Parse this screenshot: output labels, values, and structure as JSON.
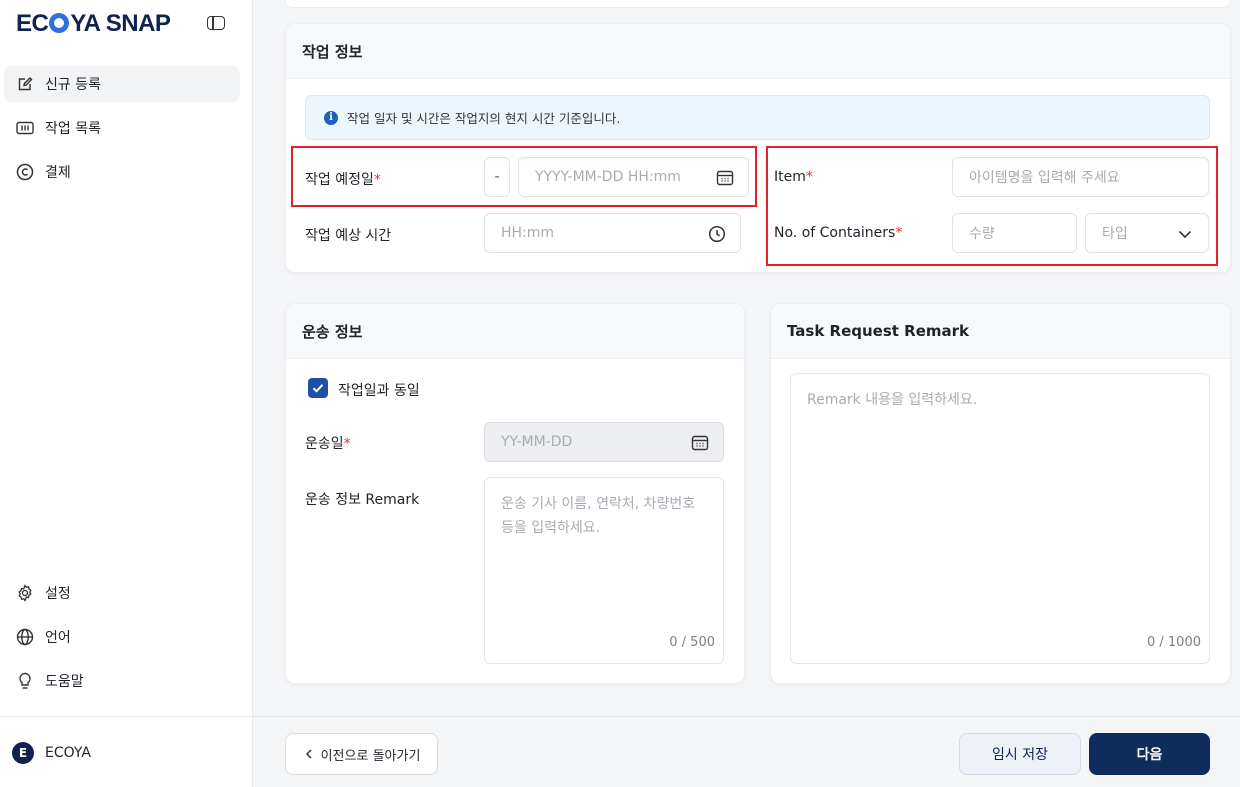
{
  "app": {
    "logo_text_pre": "EC",
    "logo_text_post": "YA SNAP"
  },
  "sidebar": {
    "items": [
      {
        "label": "신규 등록",
        "icon": "edit-icon"
      },
      {
        "label": "작업 목록",
        "icon": "list-icon"
      },
      {
        "label": "결제",
        "icon": "copyright-icon"
      }
    ],
    "bottom_items": [
      {
        "label": "설정",
        "icon": "gear-icon"
      },
      {
        "label": "언어",
        "icon": "globe-icon"
      },
      {
        "label": "도움말",
        "icon": "lightbulb-icon"
      }
    ],
    "user": {
      "initial": "E",
      "name": "ECOYA"
    }
  },
  "work_info": {
    "title": "작업 정보",
    "notice": "작업 일자 및 시간은 작업지의 현지 시간 기준입니다.",
    "scheduled_date_label": "작업 예정일",
    "scheduled_date_prefix": "-",
    "scheduled_date_placeholder": "YYYY-MM-DD HH:mm",
    "expected_time_label": "작업 예상 시간",
    "expected_time_placeholder": "HH:mm",
    "item_label": "Item",
    "item_placeholder": "아이템명을 입력해 주세요",
    "containers_label": "No. of Containers",
    "quantity_placeholder": "수량",
    "type_placeholder": "타입",
    "required_mark": "*"
  },
  "transport": {
    "title": "운송 정보",
    "same_as_work_label": "작업일과 동일",
    "same_as_work_checked": true,
    "date_label": "운송일",
    "date_placeholder": "YY-MM-DD",
    "remark_label": "운송 정보 Remark",
    "remark_placeholder": "운송 기사 이름, 연락처, 차량번호 등을 입력하세요.",
    "remark_counter": "0 / 500"
  },
  "task_remark": {
    "title": "Task Request Remark",
    "placeholder": "Remark 내용을 입력하세요.",
    "counter": "0 / 1000"
  },
  "footer": {
    "back_label": "이전으로 돌아가기",
    "temp_save_label": "임시 저장",
    "next_label": "다음"
  },
  "colors": {
    "primary": "#0f2d5c",
    "required": "#e03131",
    "highlight_box": "#e0232b",
    "notice_bg": "#eef6fd"
  }
}
